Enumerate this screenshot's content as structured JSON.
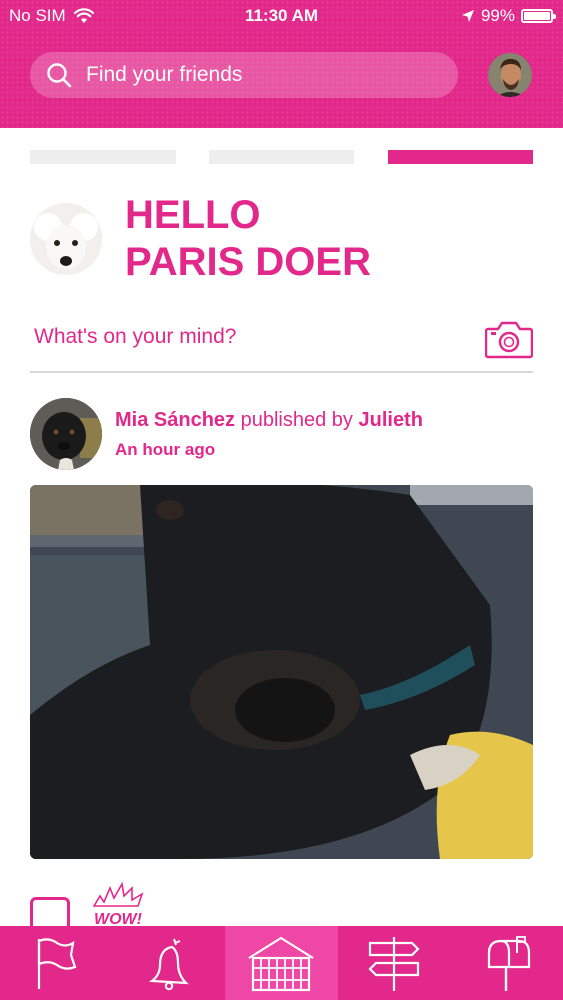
{
  "status_bar": {
    "carrier": "No SIM",
    "time": "11:30 AM",
    "battery": "99%",
    "battery_level": 0.99
  },
  "search": {
    "placeholder": "Find your friends"
  },
  "header_tabs": [
    {
      "active": false
    },
    {
      "active": false
    },
    {
      "active": true
    }
  ],
  "greeting": {
    "line1": "HELLO",
    "line2": "PARIS DOER"
  },
  "compose": {
    "placeholder": "What's on your mind?"
  },
  "post": {
    "author": "Mia Sánchez",
    "published_by_text": "published by",
    "publisher": "Julieth",
    "time": "An hour ago",
    "reaction_badge": "WOW!"
  },
  "tabbar": {
    "items": [
      {
        "icon": "flag-icon"
      },
      {
        "icon": "bell-icon"
      },
      {
        "icon": "house-icon",
        "active": true
      },
      {
        "icon": "signpost-icon"
      },
      {
        "icon": "mailbox-icon"
      }
    ]
  },
  "colors": {
    "brand": "#e2288a",
    "brand_light": "#ef47a5",
    "tab_inactive": "#eeeeee"
  }
}
